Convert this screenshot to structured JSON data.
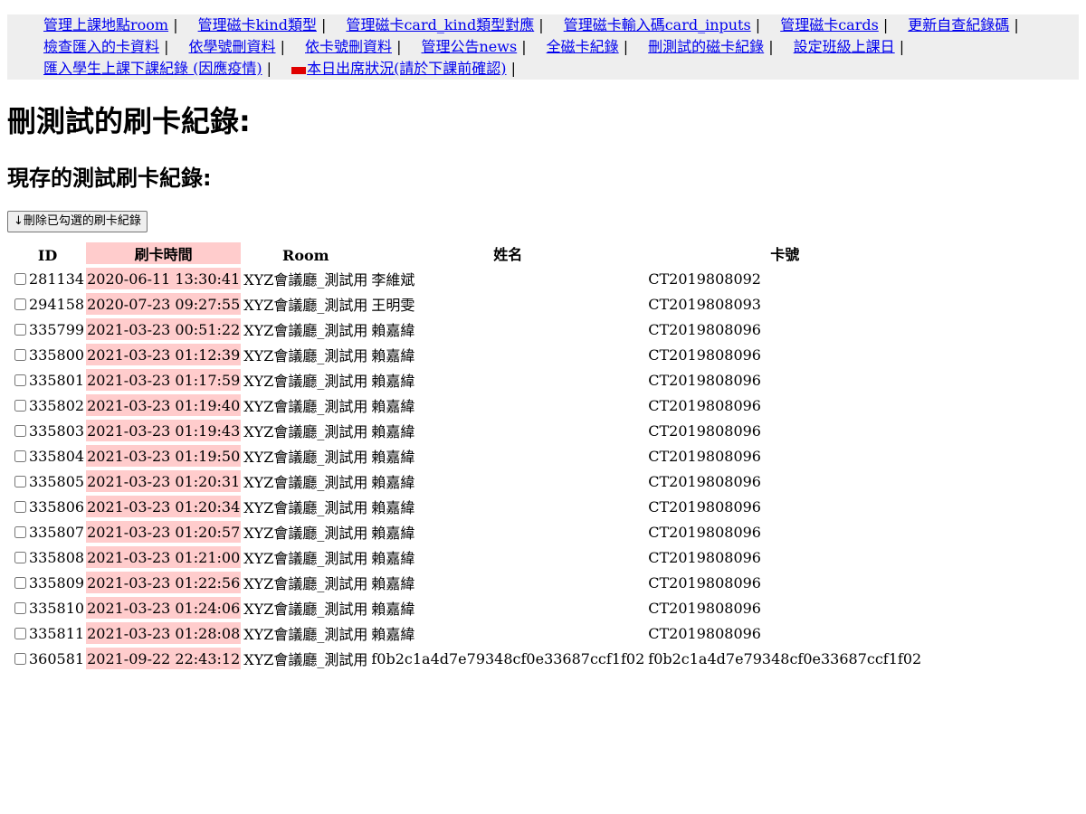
{
  "nav": {
    "lines": [
      [
        {
          "label": "管理上課地點room",
          "name": "nav-manage-room"
        },
        {
          "label": "管理磁卡kind類型",
          "name": "nav-manage-kind"
        },
        {
          "label": "管理磁卡card_kind類型對應",
          "name": "nav-manage-card-kind"
        },
        {
          "label": "管理磁卡輸入碼card_inputs",
          "name": "nav-manage-card-inputs"
        },
        {
          "label": "管理磁卡cards",
          "name": "nav-manage-cards"
        },
        {
          "label": "更新自查紀錄碼",
          "name": "nav-update-check-code"
        }
      ],
      [
        {
          "label": "檢查匯入的卡資料",
          "name": "nav-check-imported"
        },
        {
          "label": "依學號刪資料",
          "name": "nav-delete-by-student-id"
        },
        {
          "label": "依卡號刪資料",
          "name": "nav-delete-by-card-no"
        },
        {
          "label": "管理公告news",
          "name": "nav-manage-news"
        },
        {
          "label": "全磁卡紀錄",
          "name": "nav-all-card-records"
        },
        {
          "label": "刪測試的磁卡紀錄",
          "name": "nav-delete-test-records"
        },
        {
          "label": "設定班級上課日",
          "name": "nav-set-class-days"
        }
      ],
      [
        {
          "label": "匯入學生上課下課紀錄 (因應疫情)",
          "name": "nav-import-attendance"
        },
        {
          "label": "本日出席狀況(請於下課前確認)",
          "name": "nav-today-attendance",
          "badge": true
        }
      ]
    ],
    "separator": "|"
  },
  "page_title": "刪測試的刷卡紀錄:",
  "section_title": "現存的測試刷卡紀錄:",
  "delete_button_label": "↓刪除已勾選的刷卡紀錄",
  "table": {
    "headers": {
      "id": "ID",
      "time": "刷卡時間",
      "room": "Room",
      "name": "姓名",
      "card": "卡號"
    },
    "rows": [
      {
        "id": "281134",
        "time": "2020-06-11 13:30:41",
        "room": "XYZ會議廳_測試用",
        "name": "李維斌",
        "card": "CT2019808092"
      },
      {
        "id": "294158",
        "time": "2020-07-23 09:27:55",
        "room": "XYZ會議廳_測試用",
        "name": "王明雯",
        "card": "CT2019808093"
      },
      {
        "id": "335799",
        "time": "2021-03-23 00:51:22",
        "room": "XYZ會議廳_測試用",
        "name": "賴嘉緯",
        "card": "CT2019808096"
      },
      {
        "id": "335800",
        "time": "2021-03-23 01:12:39",
        "room": "XYZ會議廳_測試用",
        "name": "賴嘉緯",
        "card": "CT2019808096"
      },
      {
        "id": "335801",
        "time": "2021-03-23 01:17:59",
        "room": "XYZ會議廳_測試用",
        "name": "賴嘉緯",
        "card": "CT2019808096"
      },
      {
        "id": "335802",
        "time": "2021-03-23 01:19:40",
        "room": "XYZ會議廳_測試用",
        "name": "賴嘉緯",
        "card": "CT2019808096"
      },
      {
        "id": "335803",
        "time": "2021-03-23 01:19:43",
        "room": "XYZ會議廳_測試用",
        "name": "賴嘉緯",
        "card": "CT2019808096"
      },
      {
        "id": "335804",
        "time": "2021-03-23 01:19:50",
        "room": "XYZ會議廳_測試用",
        "name": "賴嘉緯",
        "card": "CT2019808096"
      },
      {
        "id": "335805",
        "time": "2021-03-23 01:20:31",
        "room": "XYZ會議廳_測試用",
        "name": "賴嘉緯",
        "card": "CT2019808096"
      },
      {
        "id": "335806",
        "time": "2021-03-23 01:20:34",
        "room": "XYZ會議廳_測試用",
        "name": "賴嘉緯",
        "card": "CT2019808096"
      },
      {
        "id": "335807",
        "time": "2021-03-23 01:20:57",
        "room": "XYZ會議廳_測試用",
        "name": "賴嘉緯",
        "card": "CT2019808096"
      },
      {
        "id": "335808",
        "time": "2021-03-23 01:21:00",
        "room": "XYZ會議廳_測試用",
        "name": "賴嘉緯",
        "card": "CT2019808096"
      },
      {
        "id": "335809",
        "time": "2021-03-23 01:22:56",
        "room": "XYZ會議廳_測試用",
        "name": "賴嘉緯",
        "card": "CT2019808096"
      },
      {
        "id": "335810",
        "time": "2021-03-23 01:24:06",
        "room": "XYZ會議廳_測試用",
        "name": "賴嘉緯",
        "card": "CT2019808096"
      },
      {
        "id": "335811",
        "time": "2021-03-23 01:28:08",
        "room": "XYZ會議廳_測試用",
        "name": "賴嘉緯",
        "card": "CT2019808096"
      },
      {
        "id": "360581",
        "time": "2021-09-22 22:43:12",
        "room": "XYZ會議廳_測試用",
        "name": "f0b2c1a4d7e79348cf0e33687ccf1f02",
        "card": "f0b2c1a4d7e79348cf0e33687ccf1f02"
      }
    ]
  },
  "colors": {
    "nav_bg": "#eeeeee",
    "link": "#0000ee",
    "highlight": "#ffcccc",
    "badge": "#e00000"
  },
  "icons": {
    "new_badge": "new-badge-icon"
  }
}
